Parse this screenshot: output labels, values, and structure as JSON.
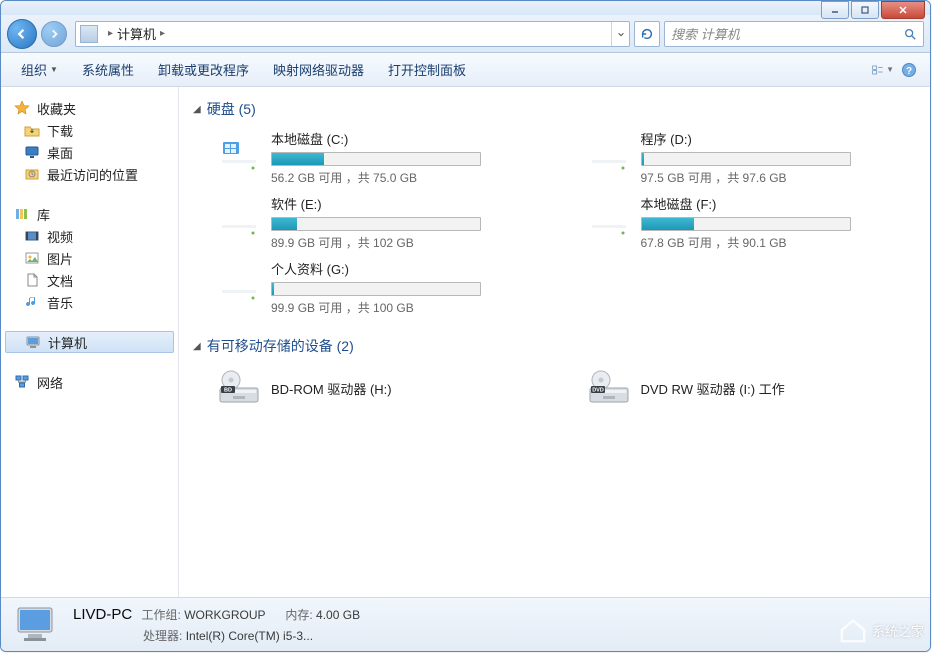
{
  "breadcrumb": {
    "root": "计算机",
    "separator": "▸"
  },
  "search": {
    "placeholder": "搜索 计算机"
  },
  "toolbar": {
    "organize": "组织",
    "properties": "系统属性",
    "uninstall": "卸载或更改程序",
    "mapdrive": "映射网络驱动器",
    "controlpanel": "打开控制面板"
  },
  "sidebar": {
    "favorites": {
      "label": "收藏夹",
      "items": [
        "下载",
        "桌面",
        "最近访问的位置"
      ]
    },
    "libraries": {
      "label": "库",
      "items": [
        "视频",
        "图片",
        "文档",
        "音乐"
      ]
    },
    "computer": "计算机",
    "network": "网络"
  },
  "groups": {
    "hdd": {
      "label": "硬盘",
      "count": 5
    },
    "removable": {
      "label": "有可移动存储的设备",
      "count": 2
    }
  },
  "drives": [
    {
      "name": "本地磁盘 (C:)",
      "free": "56.2 GB",
      "total": "75.0 GB",
      "pct": 25,
      "os": true
    },
    {
      "name": "程序 (D:)",
      "free": "97.5 GB",
      "total": "97.6 GB",
      "pct": 1
    },
    {
      "name": "软件 (E:)",
      "free": "89.9 GB",
      "total": "102 GB",
      "pct": 12
    },
    {
      "name": "本地磁盘 (F:)",
      "free": "67.8 GB",
      "total": "90.1 GB",
      "pct": 25
    },
    {
      "name": "个人资料 (G:)",
      "free": "99.9 GB",
      "total": "100 GB",
      "pct": 1
    }
  ],
  "drive_sub_template": {
    "avail": "可用",
    "sep": "，共"
  },
  "removables": [
    {
      "name": "BD-ROM 驱动器 (H:)",
      "badge": "BD"
    },
    {
      "name": "DVD RW 驱动器 (I:) 工作",
      "badge": "DVD"
    }
  ],
  "details": {
    "name": "LIVD-PC",
    "workgroup_label": "工作组:",
    "workgroup": "WORKGROUP",
    "memory_label": "内存:",
    "memory": "4.00 GB",
    "cpu_label": "处理器:",
    "cpu": "Intel(R) Core(TM) i5-3..."
  },
  "watermark": "系统之家"
}
